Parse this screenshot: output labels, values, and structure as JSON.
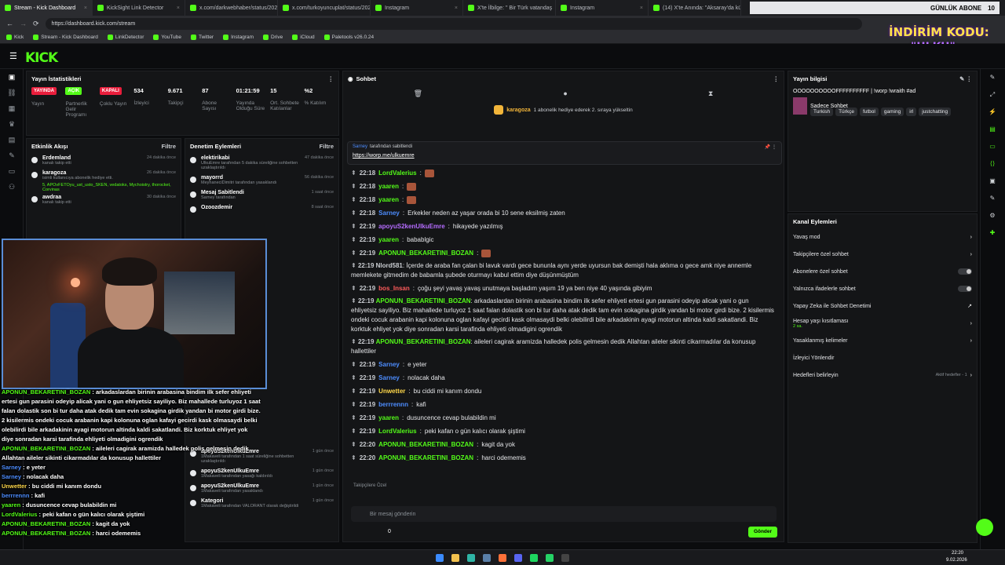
{
  "browser": {
    "tabs": [
      {
        "label": "Stream - Kick Dashboard",
        "active": true
      },
      {
        "label": "KickSight Link Detector"
      },
      {
        "label": "x.com/darkwebhaber/status/2020"
      },
      {
        "label": "x.com/turkoyuncuplat/status/2020"
      },
      {
        "label": "Instagram"
      },
      {
        "label": "X'te İlbilge: \" Bir Türk vatandaş"
      },
      {
        "label": "Instagram"
      },
      {
        "label": "(14) X'te Anında: \"Aksaray'da küçü"
      }
    ],
    "url": "https://dashboard.kick.com/stream",
    "bookmarks": [
      "Kick",
      "Stream - Kick Dashboard",
      "LinkDetector",
      "YouTube",
      "Twitter",
      "Instagram",
      "Drive",
      "iCloud",
      "Paletools v26.0.24"
    ]
  },
  "overlay": {
    "goal_label": "GÜNLÜK ABONE",
    "goal_count": "10",
    "promo": "İNDİRİM KODU:",
    "code": "\"ULKU\""
  },
  "stats_panel": {
    "title": "Yayın İstatistikleri",
    "badges": [
      {
        "label": "YAYINDA",
        "color": "#e91e3c"
      },
      {
        "label": "AÇIK",
        "color": "#53fc18"
      },
      {
        "label": "KAPALI",
        "color": "#e91e3c"
      }
    ],
    "badge_captions": [
      "Yayın",
      "Partnerlik Gelir Programı",
      "Çoklu Yayın"
    ],
    "items": [
      {
        "value": "534",
        "label": "İzleyici"
      },
      {
        "value": "9.671",
        "label": "Takipçi"
      },
      {
        "value": "87",
        "label": "Abone Sayısı"
      },
      {
        "value": "01:21:59",
        "label": "Yayında Olduğu Süre"
      },
      {
        "value": "15",
        "label": "Ort. Sohbete Katılanlar"
      },
      {
        "value": "%2",
        "label": "% Katılım"
      }
    ]
  },
  "activity": {
    "title": "Etkinlik Akışı",
    "filter": "Filtre",
    "items": [
      {
        "name": "Erdemland",
        "sub": "kanalı takip etti",
        "ago": "24 dakika önce"
      },
      {
        "name": "karagoza",
        "sub": "isimli kullanıcıya abonelik hediye etti.",
        "ago": "26 dakika önce"
      },
      {
        "name": "awdraa",
        "sub": "kanalı takip etti",
        "ago": "30 dakika önce"
      }
    ],
    "gift_recipients": "5, APOvFETOyu_ust_usto_SKEN, vedatoks, Mychoistry, thorocket, Corvinas"
  },
  "moderation": {
    "title": "Denetim Eylemleri",
    "filter": "Filtre",
    "items": [
      {
        "name": "elektirikabi",
        "sub": "UlkuEmre tarafından 5 dakika süreliğine sohbetten uzaklaştırıldı",
        "ago": "47 dakika önce"
      },
      {
        "name": "mayorrd",
        "sub": "MeyhaneciDimitri tarafından yasaklandı",
        "ago": "56 dakika önce"
      },
      {
        "name": "Mesaj Sabitlendi",
        "sub": "Sarney tarafından",
        "ago": "1 saat önce"
      },
      {
        "name": "Ozoozdemir",
        "sub": "",
        "ago": "8 saat önce"
      }
    ],
    "lower_items": [
      {
        "name": "apoyuS2kenUlkuEmre",
        "sub": "1Makaveli tarafından 1 saat süreliğine sohbetten uzaklaştırıldı",
        "ago": "1 gün önce"
      },
      {
        "name": "apoyuS2kenUlkuEmre",
        "sub": "1Makaveli tarafından yasağı kaldırıldı",
        "ago": "1 gün önce"
      },
      {
        "name": "apoyuS2kenUlkuEmre",
        "sub": "1Makaveli tarafından yasaklandı",
        "ago": "1 gün önce"
      },
      {
        "name": "Kategori",
        "sub": "1Makaveli tarafından VALORANT olarak değiştirildi",
        "ago": "1 gün önce"
      }
    ]
  },
  "chat": {
    "title": "Sohbet",
    "gift_notice": {
      "user": "karagoza",
      "count": "5",
      "text": "1 abonelik hediye ederek 2. sıraya yükseltin"
    },
    "pinned": {
      "by": "Sarney",
      "label": "tarafından sabitlendi",
      "link": "https://worp.me/ulkuemre"
    },
    "messages": [
      {
        "time": "22:18",
        "user": "LordValerius",
        "color": "#53fc18",
        "text": ""
      },
      {
        "time": "22:18",
        "user": "yaaren",
        "color": "#53fc18",
        "text": ""
      },
      {
        "time": "22:18",
        "user": "yaaren",
        "color": "#53fc18",
        "text": ""
      },
      {
        "time": "22:18",
        "user": "Sarney",
        "color": "#4d8dff",
        "text": "Erkekler neden az yaşar orada bi 10 sene eksilmiş zaten"
      },
      {
        "time": "22:19",
        "user": "apoyuS2kenUlkuEmre",
        "color": "#b56cff",
        "text": "hikayede yazılmış"
      },
      {
        "time": "22:19",
        "user": "yaaren",
        "color": "#53fc18",
        "text": "babablgic"
      },
      {
        "time": "22:19",
        "user": "APONUN_BEKARETINI_BOZAN",
        "color": "#53fc18",
        "text": ""
      },
      {
        "time": "22:19",
        "user": "Nlord581",
        "color": "#c9ccd1",
        "text": "İçerde de araba fan çalan bi lavuk vardı gece bununla aynı yerde uyursun bak demişti hala aklıma o gece amk niye annemle memlekete gitmedim de babamla şubede oturmayı kabul ettim diye düşünmüştüm"
      },
      {
        "time": "22:19",
        "user": "bos_Insan",
        "color": "#ff5b5b",
        "text": "çoğu şeyi yavaş yavaş unutmaya başladım yaşım 19 ya ben niye 40 yaşında gibiyim"
      },
      {
        "time": "22:19",
        "user": "APONUN_BEKARETINI_BOZAN",
        "color": "#53fc18",
        "text": "arkadaslardan birinin arabasina bindim ilk sefer ehliyeti ertesi gun parasini odeyip alicak yani o gun ehliyetsiz sayiliyo. Biz mahallede turluyoz 1 saat falan dolastik son bi tur daha atak dedik tam evin sokagina girdik yandan bi motor girdi bize. 2 kisilermis ondeki cocuk arabanin kapi kolonuna oglan kafayi gecirdi kask olmasaydi belki olebilirdi bile arkadakinin ayagi motorun altinda kaldi sakatlandi. Biz korktuk ehliyet yok diye sonradan karsi tarafinda ehliyeti olmadigini ogrendik"
      },
      {
        "time": "22:19",
        "user": "APONUN_BEKARETINI_BOZAN",
        "color": "#53fc18",
        "text": "aileleri cagirak aramizda halledek polis gelmesin dedik Allahtan aileler sikinti cikarmadılar da konusup hallettiler"
      },
      {
        "time": "22:19",
        "user": "Sarney",
        "color": "#4d8dff",
        "text": "e yeter"
      },
      {
        "time": "22:19",
        "user": "Sarney",
        "color": "#4d8dff",
        "text": "nolacak daha"
      },
      {
        "time": "22:19",
        "user": "Unwetter",
        "color": "#ffd84a",
        "text": "bu ciddi mi kanım dondu"
      },
      {
        "time": "22:19",
        "user": "berrrennn",
        "color": "#4d8dff",
        "text": "kafi"
      },
      {
        "time": "22:19",
        "user": "yaaren",
        "color": "#53fc18",
        "text": "dusuncence cevap bulabildin mi"
      },
      {
        "time": "22:19",
        "user": "LordValerius",
        "color": "#53fc18",
        "text": "peki kafan o gün kalıcı olarak şiştimi"
      },
      {
        "time": "22:20",
        "user": "APONUN_BEKARETINI_BOZAN",
        "color": "#53fc18",
        "text": "kagit da yok"
      },
      {
        "time": "22:20",
        "user": "APONUN_BEKARETINI_BOZAN",
        "color": "#53fc18",
        "text": "harci odememis"
      }
    ],
    "followers_only": "Takipçilere Özel",
    "input_placeholder": "Bir mesaj gönderin",
    "send": "Gönder",
    "count": "0"
  },
  "stream_info": {
    "title": "Yayın bilgisi",
    "stream_title": "OOOOOOOOOOFFFFFFFFFF | !worp !wraith #ad",
    "category": "Sadece Sohbet",
    "tags": [
      "Turkish",
      "Türkçe",
      "futbol",
      "gaming",
      "irl",
      "justchatting"
    ]
  },
  "channel_actions": {
    "title": "Kanal Eylemleri",
    "items": [
      {
        "label": "Yavaş mod",
        "kind": "arrow"
      },
      {
        "label": "Takipçilere özel sohbet",
        "kind": "arrow"
      },
      {
        "label": "Abonelere özel sohbet",
        "kind": "toggle"
      },
      {
        "label": "Yalnızca ifadelerle sohbet",
        "kind": "toggle"
      },
      {
        "label": "Yapay Zeka ile Sohbet Denetimi",
        "kind": "link"
      },
      {
        "label": "Hesap yaşı kısıtlaması",
        "kind": "arrow",
        "sub": "2 sa."
      },
      {
        "label": "Yasaklanmış kelimeler",
        "kind": "arrow"
      },
      {
        "label": "İzleyici Yönlendir",
        "kind": "none"
      },
      {
        "label": "Hedefleri belirleyin",
        "kind": "arrow",
        "sub_right": "Aktif hedefler - 1"
      }
    ]
  },
  "overlay_chat": [
    {
      "user": "APONUN_BEKARETINI_BOZAN",
      "text": "arkadaslardan birinin arabasina bindim ilk sefer ehliyeti ertesi gun parasini odeyip alicak yani o gun ehliyetsiz sayiliyo. Biz mahallede turluyoz 1 saat falan dolastik son bi tur daha atak dedik tam evin sokagina girdik yandan bi motor girdi bize. 2 kisilermis ondeki cocuk arabanin kapi kolonuna oglan kafayi gecirdi kask olmasaydi belki olebilirdi bile arkadakinin ayagi motorun altinda kaldi sakatlandi. Biz korktuk ehliyet yok diye sonradan karsi tarafinda ehliyeti olmadigini ogrendik"
    },
    {
      "user": "APONUN_BEKARETINI_BOZAN",
      "text": "aileleri cagirak aramizda halledek polis gelmesin dedik Allahtan aileler sikinti cikarmadılar da konusup hallettiler"
    },
    {
      "user": "Sarney",
      "text": "e yeter"
    },
    {
      "user": "Sarney",
      "text": "nolacak daha"
    },
    {
      "user": "Unwetter",
      "text": "bu ciddi mi kanım dondu"
    },
    {
      "user": "berrrennn",
      "text": "kafi"
    },
    {
      "user": "yaaren",
      "text": "dusuncence cevap bulabildin mi"
    },
    {
      "user": "LordValerius",
      "text": "peki kafan o gün kalıcı olarak şiştimi"
    },
    {
      "user": "APONUN_BEKARETINI_BOZAN",
      "text": "kagit da yok"
    },
    {
      "user": "APONUN_BEKARETINI_BOZAN",
      "text": "harci odememis"
    }
  ],
  "taskbar": {
    "time": "22:20",
    "date": "9.02.2026"
  }
}
